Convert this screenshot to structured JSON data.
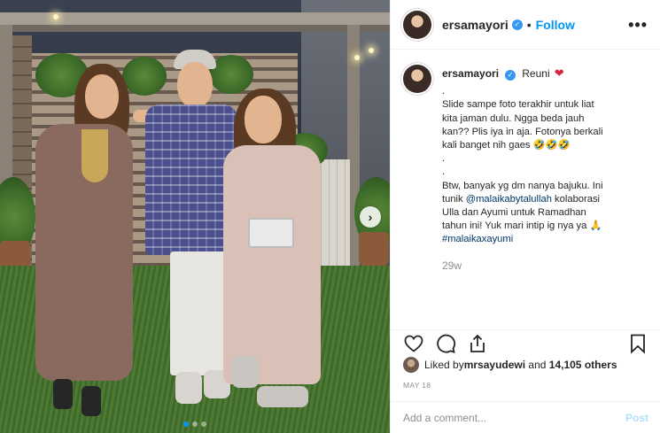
{
  "post": {
    "username": "ersamayori",
    "verified_mark": "✓",
    "separator": "•",
    "follow_label": "Follow",
    "more_label": "•••",
    "caption_title": "Reuni",
    "caption_heart": "❤",
    "caption_lines": [
      ".",
      "Slide sampe foto terakhir untuk liat",
      "kita jaman dulu. Ngga beda jauh",
      "kan?? Plis iya in aja. Fotonya berkali",
      "kali banget nih gaes 🤣🤣🤣",
      ".",
      ".",
      "Btw, banyak yg dm nanya bajuku. Ini"
    ],
    "caption_tunik_prefix": "tunik ",
    "caption_mention": "@malaikabytalullah",
    "caption_tunik_suffix": " kolaborasi",
    "caption_lines_after": [
      "Ulla dan Ayumi untuk Ramadhan",
      "tahun ini! Yuk mari intip ig nya ya 🙏"
    ],
    "caption_hashtag": "#malaikaxayumi",
    "relative_time": "29w",
    "likes_prefix": "Liked by ",
    "likes_user": "mrsayudewi",
    "likes_middle": " and ",
    "likes_count": "14,105 others",
    "date": "MAY 18",
    "comment_placeholder": "Add a comment...",
    "post_label": "Post"
  },
  "carousel": {
    "next_arrow": "›",
    "dots": 3,
    "active_dot": 0
  },
  "colors": {
    "accent": "#0095f6",
    "verified": "#3897f0",
    "muted": "#8e8e8e",
    "post_disabled": "#b2dffc"
  },
  "icons": {
    "like": "heart-outline-icon",
    "comment": "comment-bubble-icon",
    "share": "share-icon",
    "save": "bookmark-icon"
  }
}
